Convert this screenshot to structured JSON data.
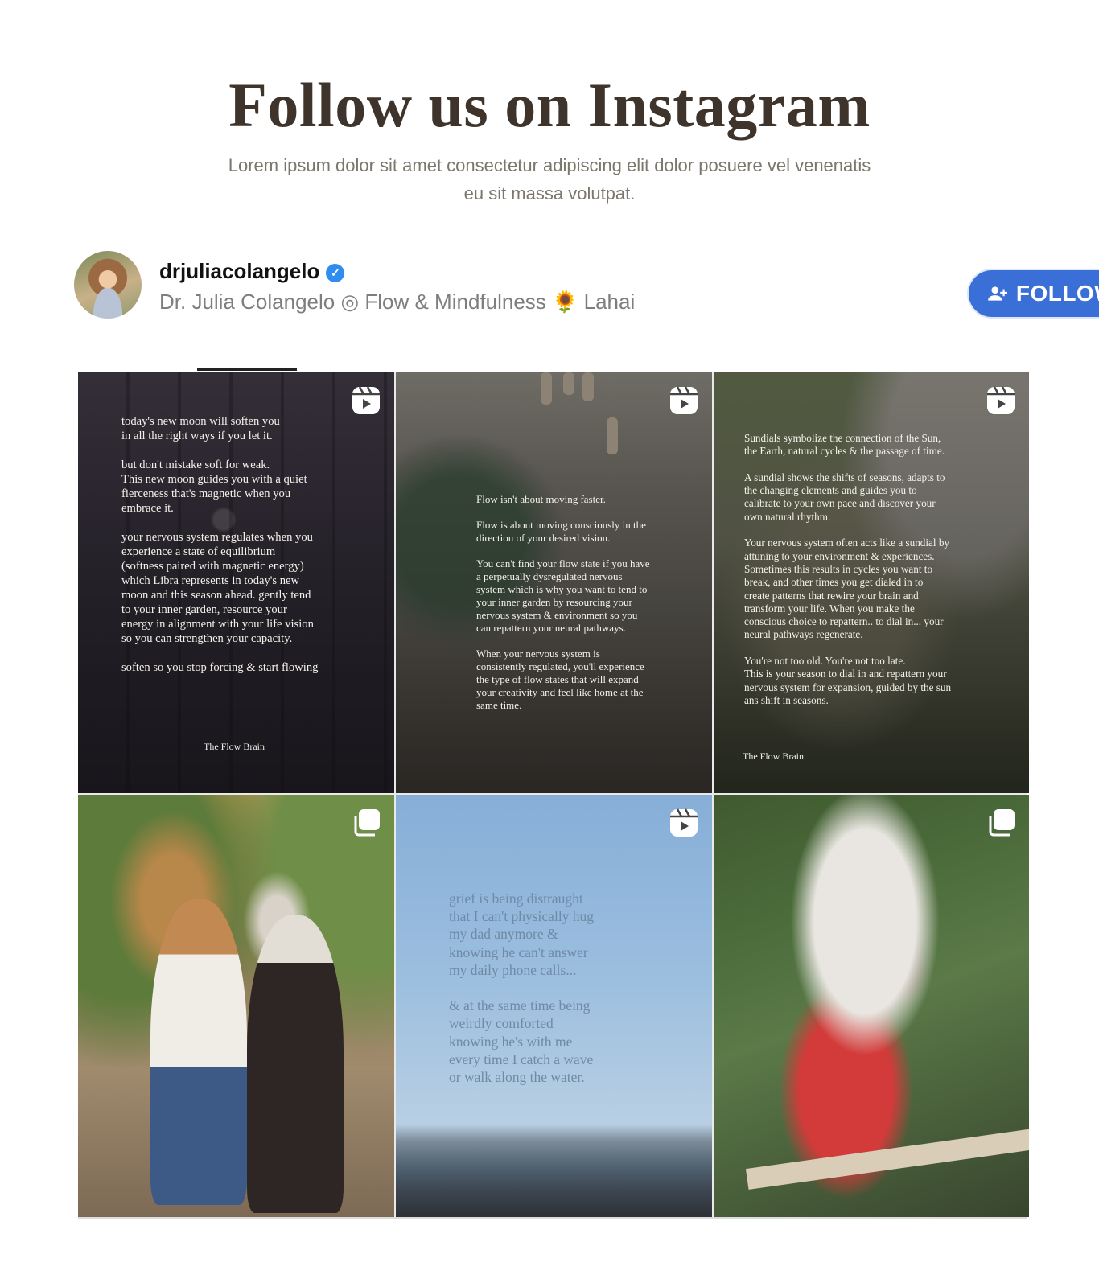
{
  "section": {
    "title": "Follow us on Instagram",
    "subtitle": "Lorem ipsum dolor sit amet consectetur adipiscing elit dolor posuere vel venenatis eu sit massa volutpat."
  },
  "profile": {
    "username": "drjuliacolangelo",
    "verified_icon": "verified-check-icon",
    "bio": "Dr. Julia Colangelo ◎ Flow & Mindfulness 🌻 Lahai",
    "follow_label": "FOLLOW",
    "follow_icon": "add-user-icon",
    "accent_color": "#3b6fd8"
  },
  "posts": [
    {
      "type": "reel",
      "badge_icon": "reels-icon",
      "caption": "today's new moon will soften you\nin all the right ways if you let it.\n\nbut don't mistake soft for weak.\nThis new moon guides you with a quiet\nfierceness that's magnetic when you\nembrace it.\n\nyour nervous system regulates when you\nexperience a state of equilibrium\n(softness paired with magnetic energy)\nwhich Libra represents in today's new\nmoon and this season ahead. gently tend\nto your inner garden, resource your\nenergy in alignment with your life vision\nso you can strengthen your capacity.\n\nsoften so you stop forcing & start flowing",
      "signature": "The Flow Brain"
    },
    {
      "type": "reel",
      "badge_icon": "reels-icon",
      "caption": "Flow isn't about moving faster.\n\nFlow is about moving consciously in the\ndirection of your desired vision.\n\nYou can't find your flow state if you have\na perpetually dysregulated nervous\nsystem which is why you want to tend to\nyour inner garden by resourcing your\nnervous system & environment so you\ncan repattern your neural pathways.\n\nWhen your nervous system is\nconsistently regulated, you'll experience\nthe type of flow states that will expand\nyour creativity and feel like home at the\nsame time."
    },
    {
      "type": "reel",
      "badge_icon": "reels-icon",
      "caption": "Sundials symbolize the connection of the Sun,\nthe Earth, natural cycles & the passage of time.\n\nA sundial shows the shifts of seasons, adapts to\nthe changing elements and guides you to\ncalibrate to your own pace and discover your\nown natural rhythm.\n\nYour nervous system often acts like a sundial by\nattuning to your environment & experiences.\nSometimes this results in cycles  you want to\nbreak, and other times you get dialed in to\ncreate patterns that rewire your brain and\ntransform your life. When you make the\nconscious choice to repattern.. to dial in... your\nneural pathways regenerate.\n\nYou're not too old. You're not too late.\nThis is your season to dial in and repattern your\nnervous system for expansion, guided by the sun\nans shift in seasons.",
      "signature": "The Flow Brain"
    },
    {
      "type": "carousel",
      "badge_icon": "carousel-icon"
    },
    {
      "type": "reel",
      "badge_icon": "reels-icon",
      "caption": "grief is being distraught\nthat I can't physically hug\nmy dad anymore &\nknowing he can't answer\nmy daily phone calls...\n\n& at the same time being\nweirdly comforted\nknowing he's with me\nevery time I catch a wave\nor walk along the water."
    },
    {
      "type": "carousel",
      "badge_icon": "carousel-icon"
    }
  ]
}
